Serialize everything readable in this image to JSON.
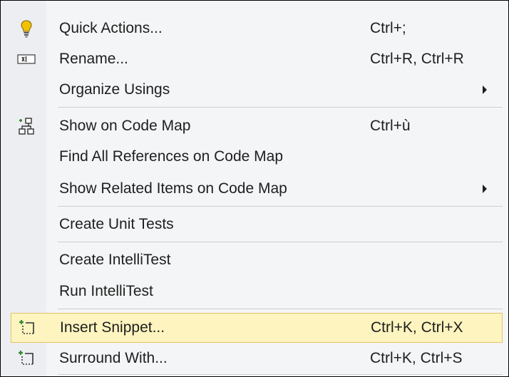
{
  "menu": {
    "items": [
      {
        "label": "Quick Actions...",
        "shortcut": "Ctrl+;",
        "icon": "lightbulb-icon"
      },
      {
        "label": "Rename...",
        "shortcut": "Ctrl+R, Ctrl+R",
        "icon": "rename-icon"
      },
      {
        "label": "Organize Usings",
        "submenu": true
      },
      {
        "label": "Show on Code Map",
        "shortcut": "Ctrl+ù",
        "icon": "code-map-icon"
      },
      {
        "label": "Find All References on Code Map"
      },
      {
        "label": "Show Related Items on Code Map",
        "submenu": true
      },
      {
        "label": "Create Unit Tests"
      },
      {
        "label": "Create IntelliTest"
      },
      {
        "label": "Run IntelliTest"
      },
      {
        "label": "Insert Snippet...",
        "shortcut": "Ctrl+K, Ctrl+X",
        "icon": "insert-snippet-icon",
        "highlighted": true
      },
      {
        "label": "Surround With...",
        "shortcut": "Ctrl+K, Ctrl+S",
        "icon": "surround-with-icon"
      }
    ]
  },
  "colors": {
    "menu_background": "#f4f5f7",
    "gutter_background": "#eceef2",
    "highlight_background": "#fdf4bf",
    "highlight_border": "#e5c365",
    "separator": "#ccced3",
    "lightbulb": "#f2c100",
    "icon_green": "#388a34"
  }
}
